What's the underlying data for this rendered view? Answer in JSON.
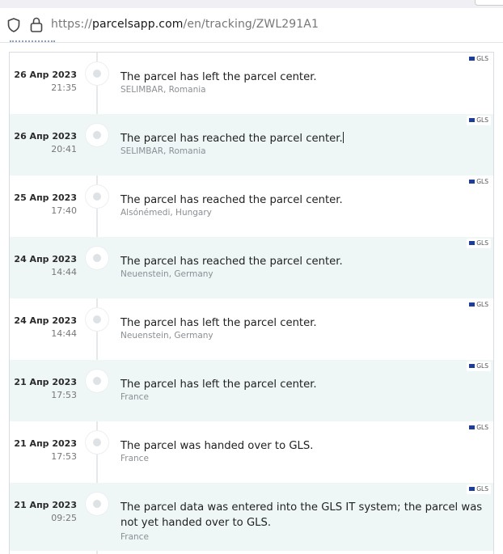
{
  "browser": {
    "url_prefix": "https://",
    "url_domain": "parcelsapp.com",
    "url_path": "/en/tracking/ZWL291A1"
  },
  "events": [
    {
      "date": "26 Апр 2023",
      "time": "21:35",
      "message": "The parcel has left the parcel center.",
      "location": "SELIMBAR, Romania",
      "carrier": "GLS"
    },
    {
      "date": "26 Апр 2023",
      "time": "20:41",
      "message": "The parcel has reached the parcel center.",
      "location": "SELIMBAR, Romania",
      "carrier": "GLS"
    },
    {
      "date": "25 Апр 2023",
      "time": "17:40",
      "message": "The parcel has reached the parcel center.",
      "location": "Alsónémedi, Hungary",
      "carrier": "GLS"
    },
    {
      "date": "24 Апр 2023",
      "time": "14:44",
      "message": "The parcel has reached the parcel center.",
      "location": "Neuenstein, Germany",
      "carrier": "GLS"
    },
    {
      "date": "24 Апр 2023",
      "time": "14:44",
      "message": "The parcel has left the parcel center.",
      "location": "Neuenstein, Germany",
      "carrier": "GLS"
    },
    {
      "date": "21 Апр 2023",
      "time": "17:53",
      "message": "The parcel has left the parcel center.",
      "location": "France",
      "carrier": "GLS"
    },
    {
      "date": "21 Апр 2023",
      "time": "17:53",
      "message": "The parcel was handed over to GLS.",
      "location": "France",
      "carrier": "GLS"
    },
    {
      "date": "21 Апр 2023",
      "time": "09:25",
      "message": "The parcel data was entered into the GLS IT system; the parcel was not yet handed over to GLS.",
      "location": "France",
      "carrier": "GLS"
    }
  ],
  "colors": {
    "row_alt_bg": "#eef6f6",
    "carrier_flag": "#1e3d9a"
  },
  "icons": [
    "shield-icon",
    "lock-icon",
    "carrier-flag-icon",
    "timeline-dot-icon"
  ]
}
